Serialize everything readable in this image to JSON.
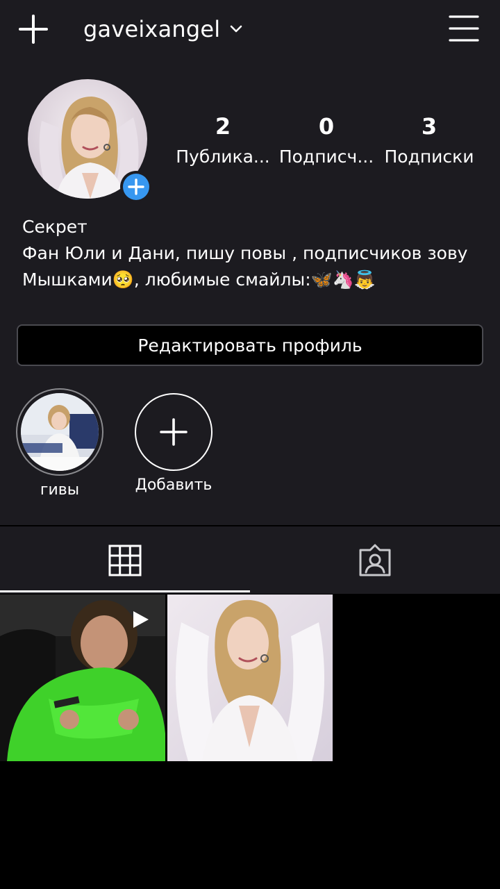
{
  "header": {
    "username": "gaveixangel",
    "add_icon": "plus-icon",
    "switch_icon": "chevron-down-icon",
    "menu_icon": "hamburger-menu-icon"
  },
  "profile": {
    "stats": [
      {
        "value": "2",
        "label": "Публика..."
      },
      {
        "value": "0",
        "label": "Подписч..."
      },
      {
        "value": "3",
        "label": "Подписки"
      }
    ],
    "bio": {
      "name": "Секрет",
      "line1": "Фан Юли и Дани, пишу повы , подписчиков зову",
      "line2": "Мышками🥺, любимые смайлы:🦋🦄👼"
    },
    "edit_label": "Редактировать профиль"
  },
  "highlights": [
    {
      "label": "гивы"
    },
    {
      "label": "Добавить"
    }
  ],
  "tabs": [
    {
      "icon": "grid-icon",
      "active": true
    },
    {
      "icon": "tagged-person-icon",
      "active": false
    }
  ],
  "colors": {
    "background": "#1c1b20",
    "accent": "#3797f0",
    "grid_bg": "#000000"
  }
}
